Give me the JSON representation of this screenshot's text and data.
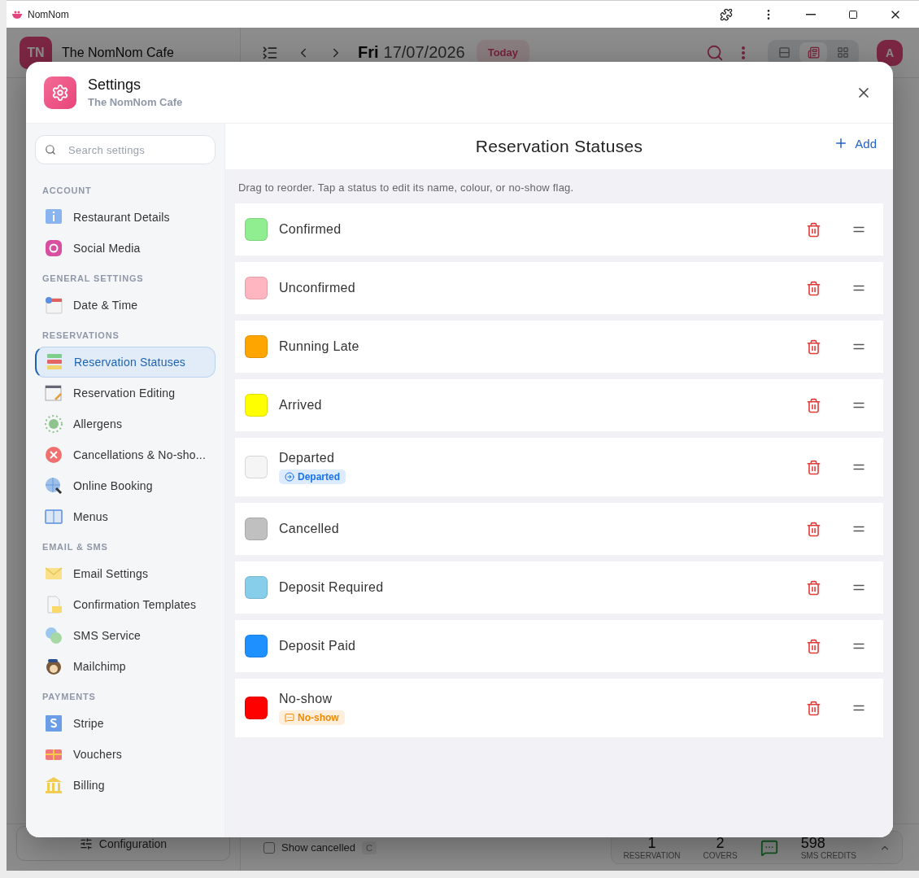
{
  "browser": {
    "title": "NomNom"
  },
  "app_header": {
    "avatar": "TN",
    "restaurant": "The NomNom Cafe",
    "day": "Fri",
    "date": "17/07/2026",
    "today_button": "Today",
    "view_toggle": [
      {
        "selected": false
      },
      {
        "selected": true
      },
      {
        "selected": false
      }
    ],
    "user_avatar": "A"
  },
  "modal": {
    "title": "Settings",
    "subtitle": "The NomNom Cafe",
    "search": {
      "placeholder": "Search settings"
    },
    "sections": [
      {
        "title": "ACCOUNT",
        "items": [
          {
            "label": "Restaurant Details",
            "selected": false
          },
          {
            "label": "Social Media",
            "selected": false
          }
        ]
      },
      {
        "title": "GENERAL SETTINGS",
        "items": [
          {
            "label": "Date & Time",
            "selected": false
          }
        ]
      },
      {
        "title": "RESERVATIONS",
        "items": [
          {
            "label": "Reservation Statuses",
            "selected": true
          },
          {
            "label": "Reservation Editing",
            "selected": false
          },
          {
            "label": "Allergens",
            "selected": false
          },
          {
            "label": "Cancellations & No-sho...",
            "selected": false
          },
          {
            "label": "Online Booking",
            "selected": false
          },
          {
            "label": "Menus",
            "selected": false
          }
        ]
      },
      {
        "title": "EMAIL & SMS",
        "items": [
          {
            "label": "Email Settings",
            "selected": false
          },
          {
            "label": "Confirmation Templates",
            "selected": false
          },
          {
            "label": "SMS Service",
            "selected": false
          },
          {
            "label": "Mailchimp",
            "selected": false
          }
        ]
      },
      {
        "title": "PAYMENTS",
        "items": [
          {
            "label": "Stripe",
            "selected": false
          },
          {
            "label": "Vouchers",
            "selected": false
          },
          {
            "label": "Billing",
            "selected": false
          }
        ]
      }
    ],
    "panel": {
      "title": "Reservation Statuses",
      "add_button": "Add",
      "hint": "Drag to reorder. Tap a status to edit its name, colour, or no-show flag.",
      "statuses": [
        {
          "name": "Confirmed",
          "color": "#90ee90"
        },
        {
          "name": "Unconfirmed",
          "color": "#ffb6c1"
        },
        {
          "name": "Running Late",
          "color": "#ffa500"
        },
        {
          "name": "Arrived",
          "color": "#ffff00"
        },
        {
          "name": "Departed",
          "color": "#f5f5f5",
          "badge": {
            "label": "Departed",
            "kind": "departed"
          }
        },
        {
          "name": "Cancelled",
          "color": "#c0c0c0"
        },
        {
          "name": "Deposit Required",
          "color": "#87ceeb"
        },
        {
          "name": "Deposit Paid",
          "color": "#1e90ff"
        },
        {
          "name": "No-show",
          "color": "#ff0000",
          "badge": {
            "label": "No-show",
            "kind": "no_show"
          }
        }
      ]
    }
  },
  "footer": {
    "configuration_button": "Configuration",
    "show_cancelled": {
      "label": "Show cancelled",
      "checked": false,
      "shortcut": "C"
    },
    "stats": [
      {
        "value": "1",
        "label": "RESERVATION"
      },
      {
        "value": "2",
        "label": "COVERS"
      }
    ],
    "sms": {
      "value": "598",
      "label": "SMS CREDITS"
    }
  }
}
